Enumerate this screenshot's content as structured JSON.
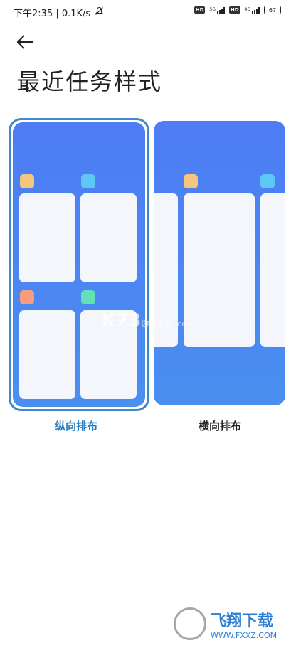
{
  "status_bar": {
    "left_text": "下午2:35 | 0.1K/s",
    "mute_icon": "bell-off-icon",
    "hd_label_1": "HD",
    "net_1": "5G",
    "hd_label_2": "HD",
    "net_2": "4G",
    "battery": "67"
  },
  "header": {
    "back_icon": "arrow-left-icon",
    "title": "最近任务样式"
  },
  "options": [
    {
      "label": "纵向排布",
      "selected": true
    },
    {
      "label": "横向排布",
      "selected": false
    }
  ],
  "colors": {
    "accent": "#2a7fc1",
    "phone_blue": "#4a8ff0",
    "card_bg": "#f4f6fb",
    "icon_yellow": "#f5c77e",
    "icon_cyan": "#5dc8f5",
    "icon_orange": "#f79d7e",
    "icon_green": "#62e0b8"
  },
  "watermark": {
    "main": "K73",
    "sub": "游戏之家 .com"
  },
  "site_logo": {
    "name": "飞翔下载",
    "url": "WWW.FXXZ.COM"
  }
}
